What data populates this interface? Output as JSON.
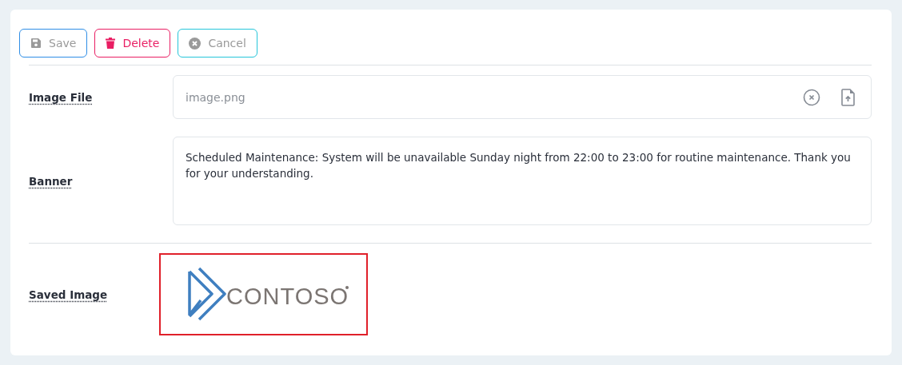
{
  "toolbar": {
    "buttons": [
      {
        "kind": "save",
        "label": "Save"
      },
      {
        "kind": "delete",
        "label": "Delete"
      },
      {
        "kind": "cancel",
        "label": "Cancel"
      }
    ]
  },
  "form": {
    "fields": [
      {
        "kind": "file",
        "label": "Image File",
        "value": "image.png"
      },
      {
        "kind": "textarea",
        "label": "Banner",
        "value": "Scheduled Maintenance: System will be unavailable Sunday night from 22:00 to 23:00 for routine maintenance. Thank you for your understanding."
      },
      {
        "kind": "image",
        "label": "Saved Image",
        "logo_text": "CONTOSO"
      }
    ]
  }
}
